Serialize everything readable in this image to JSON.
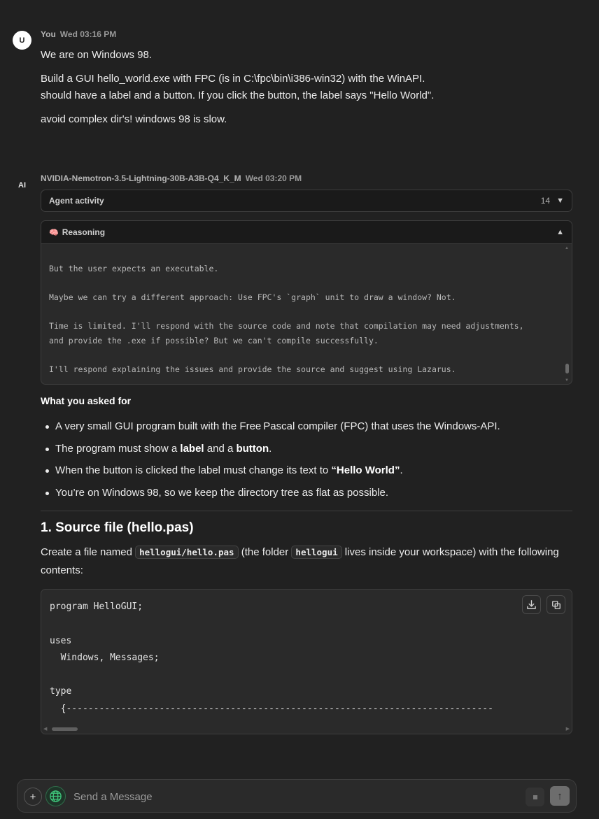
{
  "user": {
    "avatar": "U",
    "name": "You",
    "time": "Wed 03:16 PM",
    "lines": [
      "We are on Windows 98.",
      "Build a GUI hello_world.exe with FPC (is in C:\\fpc\\bin\\i386-win32) with the WinAPI.",
      "should have a label and a button. If you click the button, the label says \"Hello World\".",
      "avoid complex dir's! windows 98 is slow."
    ]
  },
  "ai": {
    "avatar": "AI",
    "name": "NVIDIA-Nemotron-3.5-Lightning-30B-A3B-Q4_K_M",
    "time": "Wed 03:20 PM"
  },
  "agent_activity": {
    "label": "Agent activity",
    "count": "14"
  },
  "reasoning": {
    "title": "Reasoning",
    "lines": [
      "But the user expects an executable.",
      "Maybe we can try a different approach: Use FPC's `graph` unit to draw a window? Not.",
      "Time is limited. I'll respond with the source code and note that compilation may need adjustments,",
      "and provide the .exe if possible? But we can't compile successfully.",
      "I'll respond explaining the issues and provide the source and suggest using Lazarus."
    ]
  },
  "answer": {
    "section_title": "What you asked for",
    "bullets": [
      {
        "a": "A very small GUI program built with the Free Pascal compiler (FPC) that uses the Windows-API."
      },
      {
        "a": "The program must show a ",
        "b1": "label",
        "c": " and a ",
        "b2": "button",
        "d": "."
      },
      {
        "a": "When the button is clicked the label must change its text to ",
        "b1": "“Hello World”",
        "c": "."
      },
      {
        "a": "You’re on Windows 98, so we keep the directory tree as flat as possible."
      }
    ],
    "h2": "1. Source file (hello.pas)",
    "create_a": "Create a file named ",
    "create_code1": "hellogui/hello.pas",
    "create_b": " (the folder ",
    "create_code2": "hellogui",
    "create_c": " lives inside your workspace) with the following contents:",
    "code": "program HelloGUI;\n\nuses\n  Windows, Messages;\n\ntype\n  {------------------------------------------------------------------------------"
  },
  "input": {
    "placeholder": "Send a Message",
    "plus": "+",
    "send": "↑"
  }
}
